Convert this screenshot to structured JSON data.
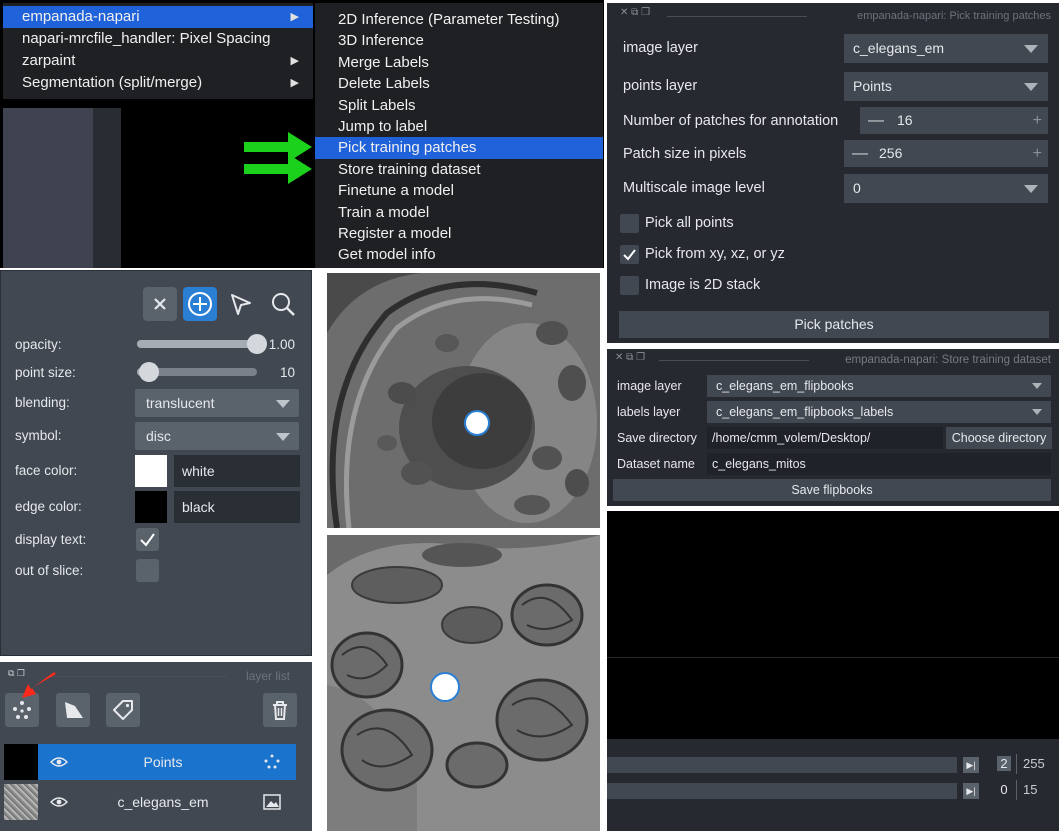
{
  "menu": {
    "main_items": [
      {
        "label": "empanada-napari",
        "has_submenu": true,
        "selected": true
      },
      {
        "label": "napari-mrcfile_handler: Pixel Spacing",
        "has_submenu": false,
        "selected": false
      },
      {
        "label": "zarpaint",
        "has_submenu": true,
        "selected": false
      },
      {
        "label": "Segmentation (split/merge)",
        "has_submenu": true,
        "selected": false
      }
    ],
    "submenu_items": [
      {
        "label": "2D Inference (Parameter Testing)",
        "selected": false
      },
      {
        "label": "3D Inference",
        "selected": false
      },
      {
        "label": "Merge Labels",
        "selected": false
      },
      {
        "label": "Delete Labels",
        "selected": false
      },
      {
        "label": "Split Labels",
        "selected": false
      },
      {
        "label": "Jump to label",
        "selected": false
      },
      {
        "label": "Pick training patches",
        "selected": true
      },
      {
        "label": "Store training dataset",
        "selected": false
      },
      {
        "label": "Finetune a model",
        "selected": false
      },
      {
        "label": "Train a model",
        "selected": false
      },
      {
        "label": "Register a model",
        "selected": false
      },
      {
        "label": "Get model info",
        "selected": false
      }
    ],
    "annotation_arrow_color": "#1bd11b"
  },
  "layer_controls": {
    "tools": [
      "close-icon",
      "add-points-icon",
      "select-points-icon",
      "zoom-icon"
    ],
    "active_tool": "add-points-icon",
    "opacity": {
      "label": "opacity:",
      "value": "1.00",
      "level": 1.0
    },
    "point_size": {
      "label": "point size:",
      "value": "10",
      "level": 0.1
    },
    "blending": {
      "label": "blending:",
      "value": "translucent"
    },
    "symbol": {
      "label": "symbol:",
      "value": "disc"
    },
    "face_color": {
      "label": "face color:",
      "value": "white",
      "swatch": "#ffffff"
    },
    "edge_color": {
      "label": "edge color:",
      "value": "black",
      "swatch": "#000000"
    },
    "display_text": {
      "label": "display text:",
      "checked": true
    },
    "out_of_slice": {
      "label": "out of slice:",
      "checked": false
    }
  },
  "layer_list": {
    "title": "layer list",
    "buttons": [
      "new-points-layer-icon",
      "new-shapes-layer-icon",
      "new-labels-layer-icon"
    ],
    "delete_icon": "trash-icon",
    "layers": [
      {
        "name": "Points",
        "selected": true,
        "type_icon": "points-icon"
      },
      {
        "name": "c_elegans_em",
        "selected": false,
        "type_icon": "image-icon"
      }
    ],
    "red_arrow_color": "#ff2a1a"
  },
  "pick_patches": {
    "title": "empanada-napari: Pick training patches",
    "image_layer": {
      "label": "image layer",
      "value": "c_elegans_em"
    },
    "points_layer": {
      "label": "points layer",
      "value": "Points"
    },
    "num_patches": {
      "label": "Number of patches for annotation",
      "value": "16"
    },
    "patch_size": {
      "label": "Patch size in pixels",
      "value": "256"
    },
    "multiscale": {
      "label": "Multiscale image level",
      "value": "0"
    },
    "pick_all": {
      "label": "Pick all points",
      "checked": false
    },
    "pick_xyz": {
      "label": "Pick from xy, xz, or yz",
      "checked": true
    },
    "is_2d": {
      "label": "Image is 2D stack",
      "checked": false
    },
    "button": "Pick patches"
  },
  "store_dataset": {
    "title": "empanada-napari: Store training dataset",
    "image_layer": {
      "label": "image layer",
      "value": "c_elegans_em_flipbooks"
    },
    "labels_layer": {
      "label": "labels layer",
      "value": "c_elegans_em_flipbooks_labels"
    },
    "save_directory": {
      "label": "Save directory",
      "value": "/home/cmm_volem/Desktop/"
    },
    "choose_button": "Choose directory",
    "dataset_name": {
      "label": "Dataset name",
      "value": "c_elegans_mitos"
    },
    "save_button": "Save flipbooks"
  },
  "viewer_dims": [
    {
      "value": "2",
      "max": "255"
    },
    {
      "value": "0",
      "max": "15"
    }
  ]
}
